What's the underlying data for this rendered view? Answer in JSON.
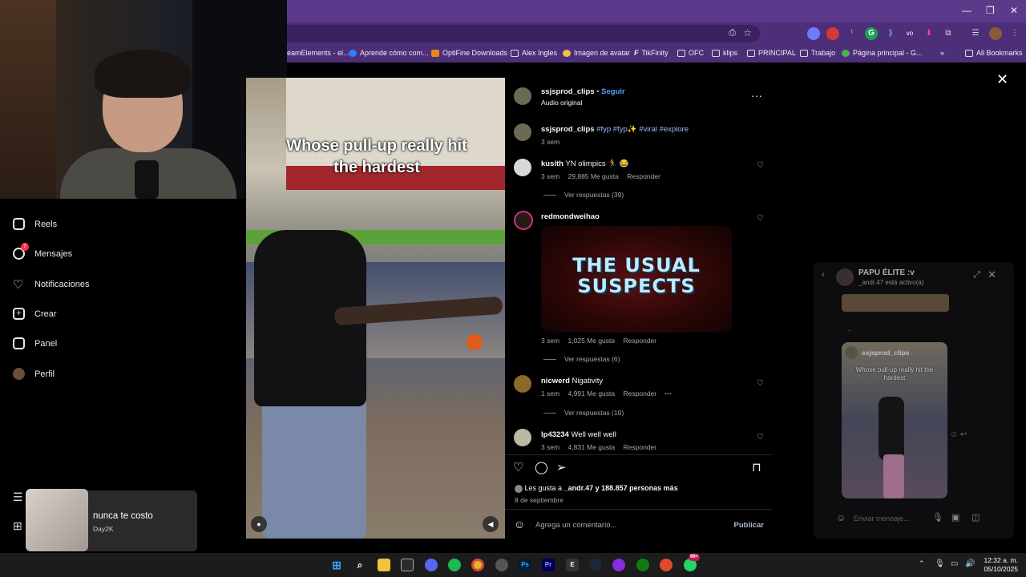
{
  "browser": {
    "bookmarks": [
      "eamElements - el...",
      "Aprende cómo com...",
      "OptiFine Downloads",
      "Alex Ingles",
      "Imagen de avatar",
      "TikFinity",
      "OFC",
      "klips",
      "PRINCIPAL",
      "Trabajo",
      "Página principal - G...",
      "All Bookmarks"
    ],
    "extension_badges": [
      "vo"
    ]
  },
  "sidebar": {
    "items": [
      {
        "label": "Reels",
        "icon": "reels-icon"
      },
      {
        "label": "Mensajes",
        "icon": "messenger-icon",
        "badge": "7"
      },
      {
        "label": "Notificaciones",
        "icon": "heart-icon"
      },
      {
        "label": "Crear",
        "icon": "plus-square-icon"
      },
      {
        "label": "Panel",
        "icon": "dashboard-icon"
      },
      {
        "label": "Perfil",
        "icon": "profile-icon"
      }
    ]
  },
  "video": {
    "caption": "Whose pull-up really hit the hardest"
  },
  "post": {
    "author": "ssjsprod_clips",
    "follow_label": "Seguir",
    "audio": "Audio original",
    "description": {
      "user": "ssjsprod_clips",
      "hashtags": "#fyp #fyp✨ #viral #explore",
      "time": "3 sem"
    },
    "comments": [
      {
        "user": "kusith",
        "text": "YN olimpics 🏃 😂",
        "time": "3 sem",
        "likes": "29,885 Me gusta",
        "reply": "Responder",
        "replies": "Ver respuestas (39)"
      },
      {
        "user": "redmondweihao",
        "text": "",
        "gif_text": "THE USUAL SUSPECTS",
        "time": "3 sem",
        "likes": "1,025 Me gusta",
        "reply": "Responder",
        "replies": "Ver respuestas (6)"
      },
      {
        "user": "nicwerd",
        "text": "Nigativity",
        "time": "1 sem",
        "likes": "4,991 Me gusta",
        "reply": "Responder",
        "replies": "Ver respuestas (10)"
      },
      {
        "user": "lp43234",
        "text": "Well well well",
        "time": "3 sem",
        "likes": "4,831 Me gusta",
        "reply": "Responder"
      }
    ],
    "likes_summary_prefix": "Les gusta a",
    "likes_summary_user": "_andr.47",
    "likes_summary_rest": "y 188.857 personas más",
    "date": "8 de septiembre",
    "comment_placeholder": "Agrega un comentario...",
    "publish_label": "Publicar"
  },
  "chat": {
    "title": "PAPU ÉLITE :v",
    "status": "_andr.47 está activo(a)",
    "shared_author": "ssjsprod_clips",
    "shared_caption": "Whose pull-up really hit the hardest",
    "input_placeholder": "Enviar mensaje..."
  },
  "spotify": {
    "song": "nunca te costo",
    "artist": "Day2K"
  },
  "taskbar": {
    "time": "12:32 a. m.",
    "date": "05/10/2025",
    "badge": "99+"
  }
}
